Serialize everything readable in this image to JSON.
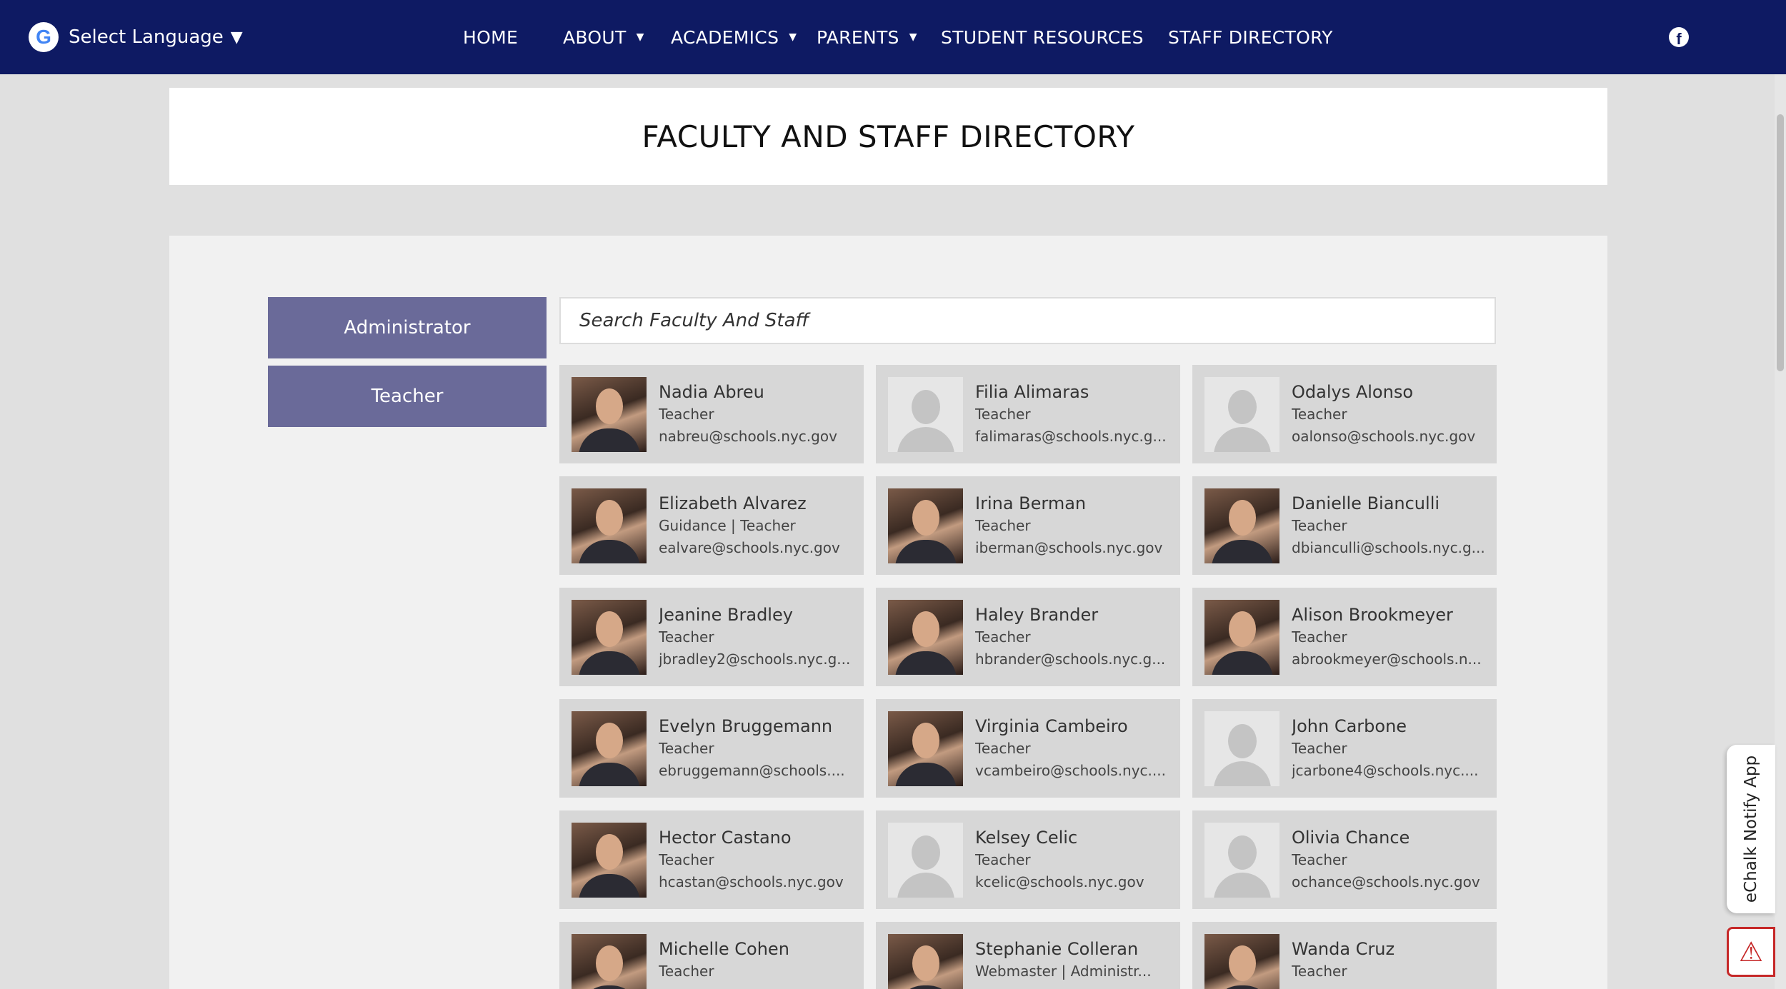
{
  "header": {
    "language_label": "Select Language",
    "language_caret": "▼",
    "google_glyph": "G",
    "nav": [
      {
        "label": "HOME",
        "dropdown": false
      },
      {
        "label": "ABOUT",
        "dropdown": true
      },
      {
        "label": "ACADEMICS",
        "dropdown": true
      },
      {
        "label": "PARENTS",
        "dropdown": true
      },
      {
        "label": "STUDENT RESOURCES",
        "dropdown": false
      },
      {
        "label": "STAFF DIRECTORY",
        "dropdown": false
      }
    ],
    "social_icon": "facebook-icon",
    "facebook_glyph": "f"
  },
  "page_title": "FACULTY AND STAFF DIRECTORY",
  "categories": [
    "Administrator",
    "Teacher"
  ],
  "search": {
    "placeholder": "Search Faculty And Staff"
  },
  "staff": [
    {
      "name": "Nadia Abreu",
      "role": "Teacher",
      "email": "nabreu@schools.nyc.gov",
      "photo": true
    },
    {
      "name": "Filia Alimaras",
      "role": "Teacher",
      "email": "falimaras@schools.nyc.g...",
      "photo": false
    },
    {
      "name": "Odalys Alonso",
      "role": "Teacher",
      "email": "oalonso@schools.nyc.gov",
      "photo": false
    },
    {
      "name": "Elizabeth Alvarez",
      "role": "Guidance  |  Teacher",
      "email": "ealvare@schools.nyc.gov",
      "photo": true
    },
    {
      "name": "Irina Berman",
      "role": "Teacher",
      "email": "iberman@schools.nyc.gov",
      "photo": true
    },
    {
      "name": "Danielle Bianculli",
      "role": "Teacher",
      "email": "dbianculli@schools.nyc.g...",
      "photo": true
    },
    {
      "name": "Jeanine Bradley",
      "role": "Teacher",
      "email": "jbradley2@schools.nyc.g...",
      "photo": true
    },
    {
      "name": "Haley Brander",
      "role": "Teacher",
      "email": "hbrander@schools.nyc.g...",
      "photo": true
    },
    {
      "name": "Alison Brookmeyer",
      "role": "Teacher",
      "email": "abrookmeyer@schools.n...",
      "photo": true
    },
    {
      "name": "Evelyn Bruggemann",
      "role": "Teacher",
      "email": "ebruggemann@schools....",
      "photo": true
    },
    {
      "name": "Virginia Cambeiro",
      "role": "Teacher",
      "email": "vcambeiro@schools.nyc....",
      "photo": true
    },
    {
      "name": "John Carbone",
      "role": "Teacher",
      "email": "jcarbone4@schools.nyc....",
      "photo": false
    },
    {
      "name": "Hector Castano",
      "role": "Teacher",
      "email": "hcastan@schools.nyc.gov",
      "photo": true
    },
    {
      "name": "Kelsey Celic",
      "role": "Teacher",
      "email": "kcelic@schools.nyc.gov",
      "photo": false
    },
    {
      "name": "Olivia Chance",
      "role": "Teacher",
      "email": "ochance@schools.nyc.gov",
      "photo": false
    },
    {
      "name": "Michelle Cohen",
      "role": "Teacher",
      "email": "",
      "photo": true
    },
    {
      "name": "Stephanie Colleran",
      "role": "Webmaster  |  Administr...",
      "email": "",
      "photo": true
    },
    {
      "name": "Wanda Cruz",
      "role": "Teacher",
      "email": "",
      "photo": true
    }
  ],
  "notify_tab": "eChalk Notify App",
  "alert_icon": "warning-icon",
  "alert_glyph": "⚠"
}
